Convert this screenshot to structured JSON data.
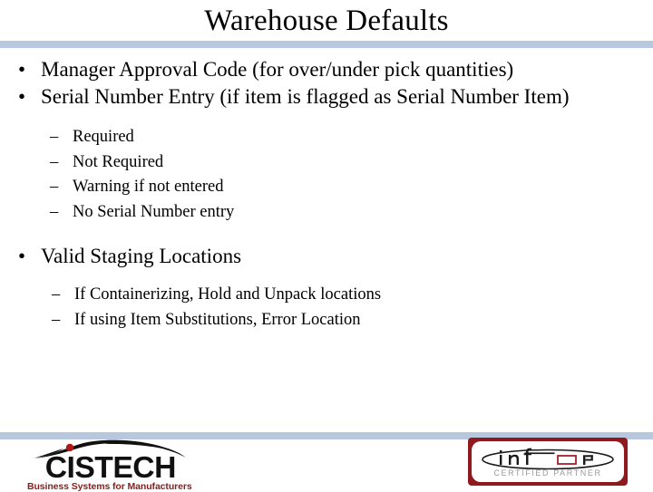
{
  "slide": {
    "title": "Warehouse Defaults",
    "accent_color": "#b6c7de",
    "background_color": "#ffffff",
    "text_color": "#000000"
  },
  "content": {
    "bullets": [
      {
        "level": 1,
        "marker": "•",
        "text": "Manager Approval Code (for over/under pick quantities)"
      },
      {
        "level": 1,
        "marker": "•",
        "text": "Serial Number Entry (if item is flagged as Serial Number Item)"
      },
      {
        "level": 2,
        "marker": "–",
        "text": "Required"
      },
      {
        "level": 2,
        "marker": "–",
        "text": "Not Required"
      },
      {
        "level": 2,
        "marker": "–",
        "text": "Warning if not entered"
      },
      {
        "level": 2,
        "marker": "–",
        "text": "No Serial Number entry"
      },
      {
        "level": 1,
        "marker": "•",
        "text": "Valid Staging Locations"
      },
      {
        "level": 2,
        "marker": "–",
        "text": "If Containerizing, Hold and Unpack locations"
      },
      {
        "level": 2,
        "marker": "–",
        "text": "If using Item Substitutions, Error Location"
      }
    ]
  },
  "footer": {
    "cistech_logo": {
      "wordmark": "CISTECH",
      "tagline": "Business Systems for Manufacturers",
      "wordmark_color": "#111111",
      "tagline_color": "#8a1c1c",
      "accent_dot_color": "#b01818"
    },
    "infor_logo": {
      "wordmark": "infor",
      "tagline": "CERTIFIED PARTNER",
      "border_color": "#8e1a1f",
      "tagline_color": "#9a9a9a"
    }
  }
}
